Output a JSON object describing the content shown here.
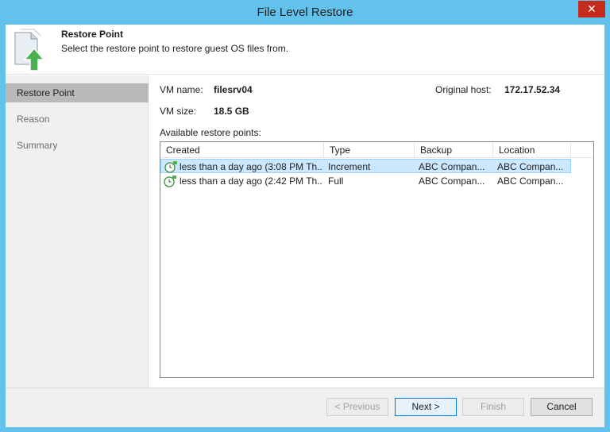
{
  "window": {
    "title": "File Level Restore",
    "close_glyph": "✕"
  },
  "header": {
    "icon": "restore-files-icon",
    "title": "Restore Point",
    "subtitle": "Select the restore point to restore guest OS files from."
  },
  "sidebar": {
    "items": [
      {
        "label": "Restore Point",
        "active": true
      },
      {
        "label": "Reason",
        "active": false
      },
      {
        "label": "Summary",
        "active": false
      }
    ]
  },
  "vm": {
    "name_label": "VM name:",
    "name": "filesrv04",
    "size_label": "VM size:",
    "size": "18.5 GB",
    "host_label": "Original host:",
    "host": "172.17.52.34"
  },
  "restore_points": {
    "label": "Available restore points:",
    "columns": [
      "Created",
      "Type",
      "Backup",
      "Location"
    ],
    "rows": [
      {
        "created": "less than a day ago (3:08 PM Th...",
        "type": "Increment",
        "backup": "ABC Compan...",
        "location": "ABC Compan...",
        "selected": true
      },
      {
        "created": "less than a day ago (2:42 PM Th...",
        "type": "Full",
        "backup": "ABC Compan...",
        "location": "ABC Compan...",
        "selected": false
      }
    ]
  },
  "buttons": {
    "previous": "< Previous",
    "next": "Next >",
    "finish": "Finish",
    "cancel": "Cancel"
  },
  "colors": {
    "titlebar": "#63c2ec",
    "selection": "#cce8ff",
    "accent_green": "#4caf50"
  }
}
